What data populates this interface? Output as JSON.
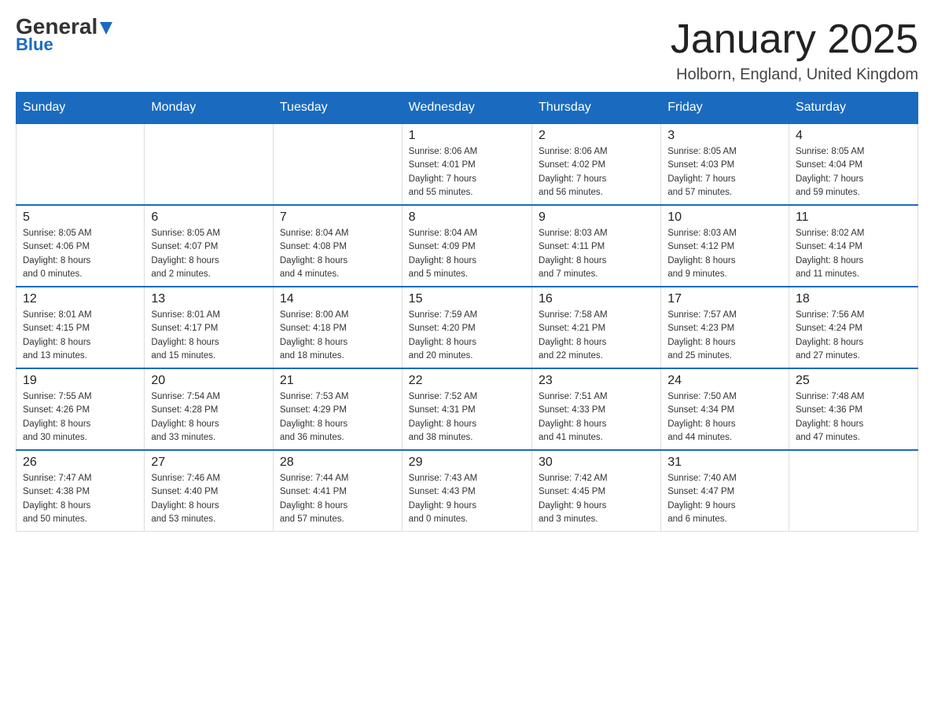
{
  "header": {
    "logo_general": "General",
    "logo_blue": "Blue",
    "month_title": "January 2025",
    "location": "Holborn, England, United Kingdom"
  },
  "days_of_week": [
    "Sunday",
    "Monday",
    "Tuesday",
    "Wednesday",
    "Thursday",
    "Friday",
    "Saturday"
  ],
  "weeks": [
    [
      {
        "day": "",
        "info": ""
      },
      {
        "day": "",
        "info": ""
      },
      {
        "day": "",
        "info": ""
      },
      {
        "day": "1",
        "info": "Sunrise: 8:06 AM\nSunset: 4:01 PM\nDaylight: 7 hours\nand 55 minutes."
      },
      {
        "day": "2",
        "info": "Sunrise: 8:06 AM\nSunset: 4:02 PM\nDaylight: 7 hours\nand 56 minutes."
      },
      {
        "day": "3",
        "info": "Sunrise: 8:05 AM\nSunset: 4:03 PM\nDaylight: 7 hours\nand 57 minutes."
      },
      {
        "day": "4",
        "info": "Sunrise: 8:05 AM\nSunset: 4:04 PM\nDaylight: 7 hours\nand 59 minutes."
      }
    ],
    [
      {
        "day": "5",
        "info": "Sunrise: 8:05 AM\nSunset: 4:06 PM\nDaylight: 8 hours\nand 0 minutes."
      },
      {
        "day": "6",
        "info": "Sunrise: 8:05 AM\nSunset: 4:07 PM\nDaylight: 8 hours\nand 2 minutes."
      },
      {
        "day": "7",
        "info": "Sunrise: 8:04 AM\nSunset: 4:08 PM\nDaylight: 8 hours\nand 4 minutes."
      },
      {
        "day": "8",
        "info": "Sunrise: 8:04 AM\nSunset: 4:09 PM\nDaylight: 8 hours\nand 5 minutes."
      },
      {
        "day": "9",
        "info": "Sunrise: 8:03 AM\nSunset: 4:11 PM\nDaylight: 8 hours\nand 7 minutes."
      },
      {
        "day": "10",
        "info": "Sunrise: 8:03 AM\nSunset: 4:12 PM\nDaylight: 8 hours\nand 9 minutes."
      },
      {
        "day": "11",
        "info": "Sunrise: 8:02 AM\nSunset: 4:14 PM\nDaylight: 8 hours\nand 11 minutes."
      }
    ],
    [
      {
        "day": "12",
        "info": "Sunrise: 8:01 AM\nSunset: 4:15 PM\nDaylight: 8 hours\nand 13 minutes."
      },
      {
        "day": "13",
        "info": "Sunrise: 8:01 AM\nSunset: 4:17 PM\nDaylight: 8 hours\nand 15 minutes."
      },
      {
        "day": "14",
        "info": "Sunrise: 8:00 AM\nSunset: 4:18 PM\nDaylight: 8 hours\nand 18 minutes."
      },
      {
        "day": "15",
        "info": "Sunrise: 7:59 AM\nSunset: 4:20 PM\nDaylight: 8 hours\nand 20 minutes."
      },
      {
        "day": "16",
        "info": "Sunrise: 7:58 AM\nSunset: 4:21 PM\nDaylight: 8 hours\nand 22 minutes."
      },
      {
        "day": "17",
        "info": "Sunrise: 7:57 AM\nSunset: 4:23 PM\nDaylight: 8 hours\nand 25 minutes."
      },
      {
        "day": "18",
        "info": "Sunrise: 7:56 AM\nSunset: 4:24 PM\nDaylight: 8 hours\nand 27 minutes."
      }
    ],
    [
      {
        "day": "19",
        "info": "Sunrise: 7:55 AM\nSunset: 4:26 PM\nDaylight: 8 hours\nand 30 minutes."
      },
      {
        "day": "20",
        "info": "Sunrise: 7:54 AM\nSunset: 4:28 PM\nDaylight: 8 hours\nand 33 minutes."
      },
      {
        "day": "21",
        "info": "Sunrise: 7:53 AM\nSunset: 4:29 PM\nDaylight: 8 hours\nand 36 minutes."
      },
      {
        "day": "22",
        "info": "Sunrise: 7:52 AM\nSunset: 4:31 PM\nDaylight: 8 hours\nand 38 minutes."
      },
      {
        "day": "23",
        "info": "Sunrise: 7:51 AM\nSunset: 4:33 PM\nDaylight: 8 hours\nand 41 minutes."
      },
      {
        "day": "24",
        "info": "Sunrise: 7:50 AM\nSunset: 4:34 PM\nDaylight: 8 hours\nand 44 minutes."
      },
      {
        "day": "25",
        "info": "Sunrise: 7:48 AM\nSunset: 4:36 PM\nDaylight: 8 hours\nand 47 minutes."
      }
    ],
    [
      {
        "day": "26",
        "info": "Sunrise: 7:47 AM\nSunset: 4:38 PM\nDaylight: 8 hours\nand 50 minutes."
      },
      {
        "day": "27",
        "info": "Sunrise: 7:46 AM\nSunset: 4:40 PM\nDaylight: 8 hours\nand 53 minutes."
      },
      {
        "day": "28",
        "info": "Sunrise: 7:44 AM\nSunset: 4:41 PM\nDaylight: 8 hours\nand 57 minutes."
      },
      {
        "day": "29",
        "info": "Sunrise: 7:43 AM\nSunset: 4:43 PM\nDaylight: 9 hours\nand 0 minutes."
      },
      {
        "day": "30",
        "info": "Sunrise: 7:42 AM\nSunset: 4:45 PM\nDaylight: 9 hours\nand 3 minutes."
      },
      {
        "day": "31",
        "info": "Sunrise: 7:40 AM\nSunset: 4:47 PM\nDaylight: 9 hours\nand 6 minutes."
      },
      {
        "day": "",
        "info": ""
      }
    ]
  ]
}
